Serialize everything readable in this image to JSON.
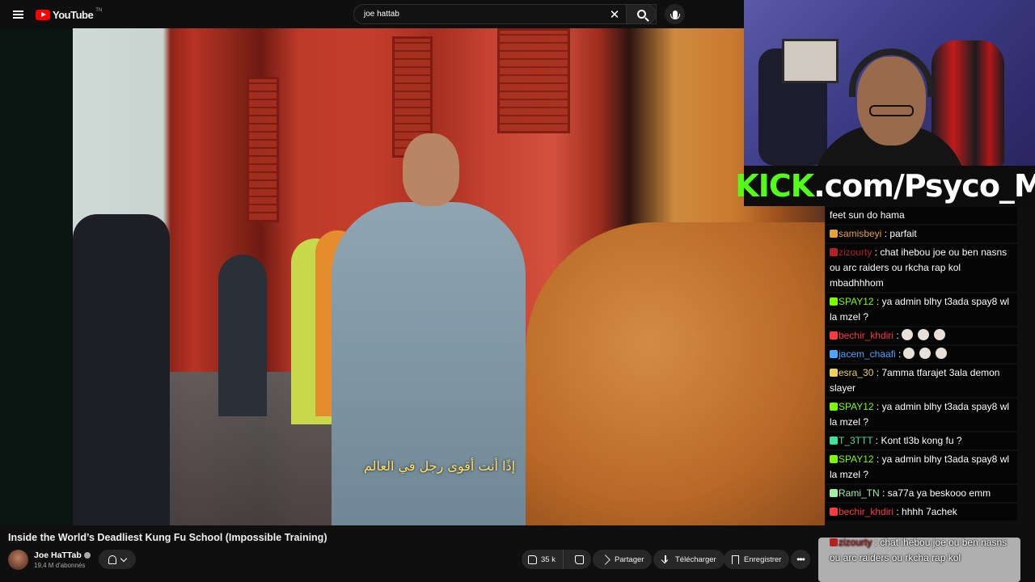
{
  "topbar": {
    "logo_text": "YouTube",
    "logo_region": "TN",
    "search_query": "joe hattab"
  },
  "video": {
    "subtitle": "إذًا أنت أقوى رجل في العالم"
  },
  "overlay": {
    "kick_brand": "KICK",
    "kick_url": ".com/Psyco_M"
  },
  "chat": {
    "messages": [
      {
        "user": "",
        "text": "feet sun do hama",
        "color": "#ffffff"
      },
      {
        "user": "samisbeyi",
        "text": " : parfait",
        "color": "#e6a23c"
      },
      {
        "user": "zizourty",
        "text": " : chat ihebou joe ou ben nasns ou arc raiders ou rkcha rap kol mbadhhhom",
        "color": "#b22222"
      },
      {
        "user": "SPAY12",
        "text": " : ya admin blhy t3ada spay8 wl la mzel ?",
        "color": "#7cfc00"
      },
      {
        "user": "bechir_khdiri",
        "text": " :",
        "color": "#ff3b3b"
      },
      {
        "user": "jacem_chaafi",
        "text": " :",
        "color": "#4da6ff"
      },
      {
        "user": "esra_30",
        "text": " : 7amma tfarajet 3ala demon slayer",
        "color": "#f0d060"
      },
      {
        "user": "SPAY12",
        "text": " : ya admin blhy t3ada spay8 wl la mzel ?",
        "color": "#7cfc00"
      },
      {
        "user": "T_3TTT",
        "text": " : Kont tl3b kong fu ?",
        "color": "#40e0a0"
      },
      {
        "user": "SPAY12",
        "text": " : ya admin blhy t3ada spay8 wl la mzel ?",
        "color": "#7cfc00"
      },
      {
        "user": "Rami_TN",
        "text": " : sa77a ya beskooo emm",
        "color": "#a0f0a0"
      },
      {
        "user": "bechir_khdiri",
        "text": " : hhhh 7achek",
        "color": "#ff3b3b"
      }
    ],
    "ghost_messages": [
      {
        "user": "zizourty",
        "text": " : chat ihebou joe ou ben nasns ou arc raiders ou rkcha rap kol",
        "color": "#b22222"
      }
    ]
  },
  "meta": {
    "title": "Inside the World’s Deadliest Kung Fu School (Impossible Training)",
    "channel_name": "Joe HaTTab",
    "subscribers": "19,4 M d'abonnés"
  },
  "actions": {
    "likes": "35 k",
    "share": "Partager",
    "download": "Télécharger",
    "save": "Enregistrer",
    "more": "•••"
  },
  "icons": [
    "menu-icon",
    "youtube-logo-icon",
    "clear-icon",
    "search-icon",
    "mic-icon",
    "bell-icon",
    "chevron-down-icon",
    "thumbs-up-icon",
    "thumbs-down-icon",
    "share-icon",
    "download-icon",
    "bookmark-icon",
    "more-icon"
  ]
}
